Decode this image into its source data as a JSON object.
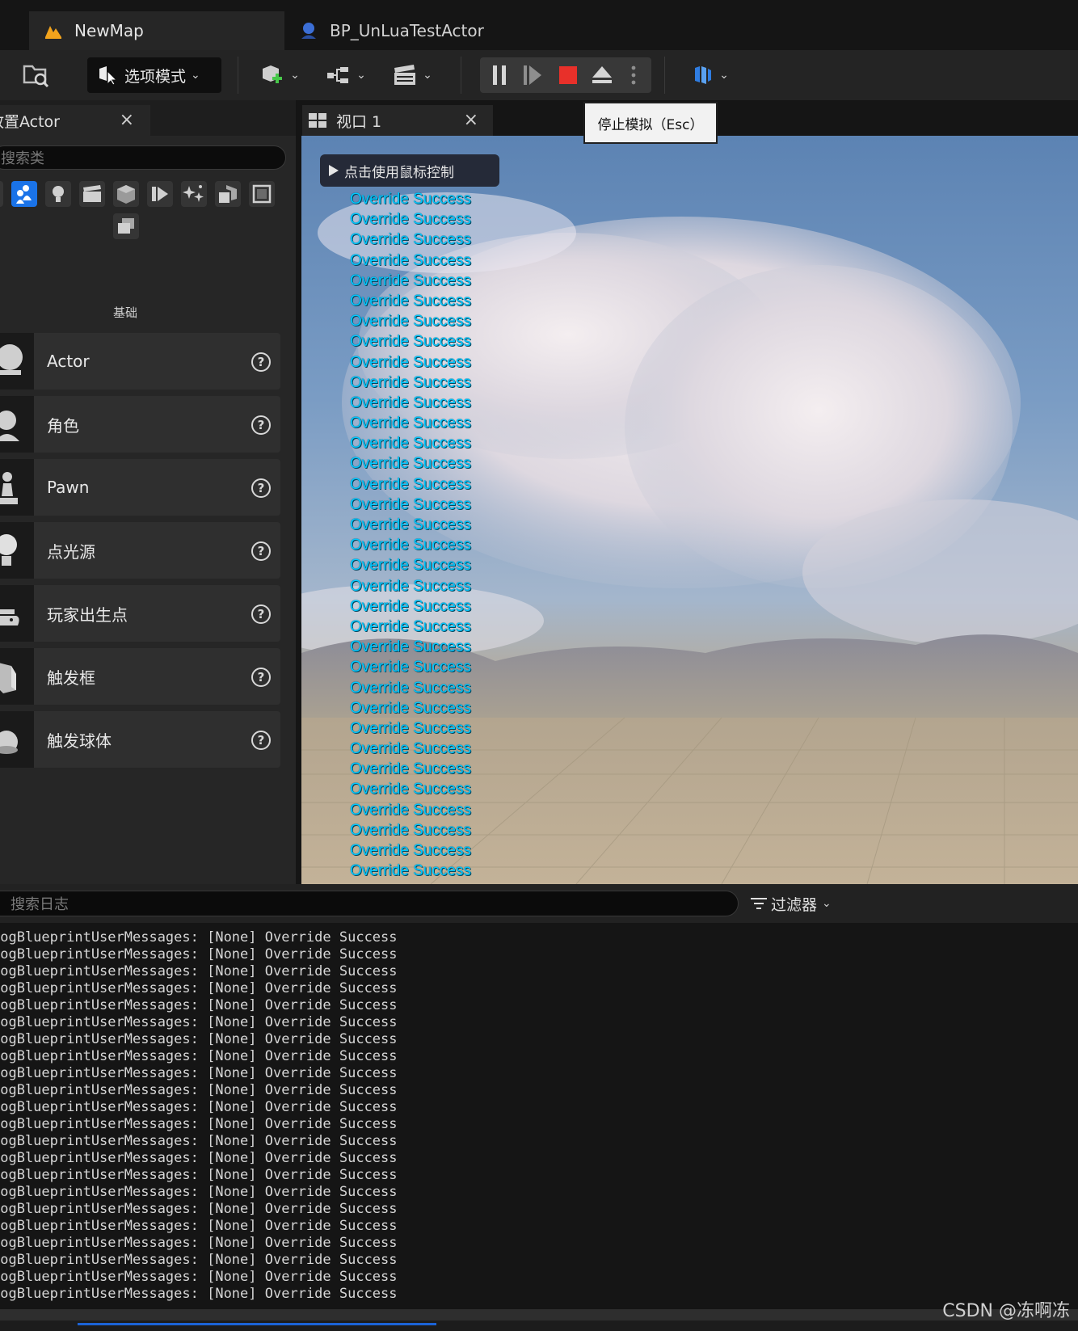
{
  "tabs": [
    {
      "label": "NewMap",
      "icon": "unreal-level-icon"
    },
    {
      "label": "BP_UnLuaTestActor",
      "icon": "blueprint-actor-icon"
    }
  ],
  "toolbar": {
    "mode_label": "选项模式",
    "tooltip": "停止模拟（Esc）",
    "stop_color": "#e8302a",
    "accent_color": "#1a73e8"
  },
  "place_actors": {
    "tab_label": "放置Actor",
    "search_placeholder": "搜索类",
    "category_label": "基础",
    "items": [
      {
        "label": "Actor"
      },
      {
        "label": "角色"
      },
      {
        "label": "Pawn"
      },
      {
        "label": "点光源"
      },
      {
        "label": "玩家出生点"
      },
      {
        "label": "触发框"
      },
      {
        "label": "触发球体"
      }
    ]
  },
  "viewport": {
    "tab_label": "视口 1",
    "mouse_hint": "点击使用鼠标控制",
    "messages": [
      "Override Success",
      "Override Success",
      "Override Success",
      "Override Success",
      "Override Success",
      "Override Success",
      "Override Success",
      "Override Success",
      "Override Success",
      "Override Success",
      "Override Success",
      "Override Success",
      "Override Success",
      "Override Success",
      "Override Success",
      "Override Success",
      "Override Success",
      "Override Success",
      "Override Success",
      "Override Success",
      "Override Success",
      "Override Success",
      "Override Success",
      "Override Success",
      "Override Success",
      "Override Success",
      "Override Success",
      "Override Success",
      "Override Success",
      "Override Success",
      "Override Success",
      "Override Success",
      "Override Success",
      "Override Success"
    ],
    "message_color": "#00c8ff"
  },
  "output_log": {
    "search_placeholder": "搜索日志",
    "filter_label": "过滤器",
    "lines": [
      "LogBlueprintUserMessages: [None] Override Success",
      "LogBlueprintUserMessages: [None] Override Success",
      "LogBlueprintUserMessages: [None] Override Success",
      "LogBlueprintUserMessages: [None] Override Success",
      "LogBlueprintUserMessages: [None] Override Success",
      "LogBlueprintUserMessages: [None] Override Success",
      "LogBlueprintUserMessages: [None] Override Success",
      "LogBlueprintUserMessages: [None] Override Success",
      "LogBlueprintUserMessages: [None] Override Success",
      "LogBlueprintUserMessages: [None] Override Success",
      "LogBlueprintUserMessages: [None] Override Success",
      "LogBlueprintUserMessages: [None] Override Success",
      "LogBlueprintUserMessages: [None] Override Success",
      "LogBlueprintUserMessages: [None] Override Success",
      "LogBlueprintUserMessages: [None] Override Success",
      "LogBlueprintUserMessages: [None] Override Success",
      "LogBlueprintUserMessages: [None] Override Success",
      "LogBlueprintUserMessages: [None] Override Success",
      "LogBlueprintUserMessages: [None] Override Success",
      "LogBlueprintUserMessages: [None] Override Success",
      "LogBlueprintUserMessages: [None] Override Success",
      "LogBlueprintUserMessages: [None] Override Success"
    ]
  },
  "watermark": "CSDN @冻啊冻"
}
